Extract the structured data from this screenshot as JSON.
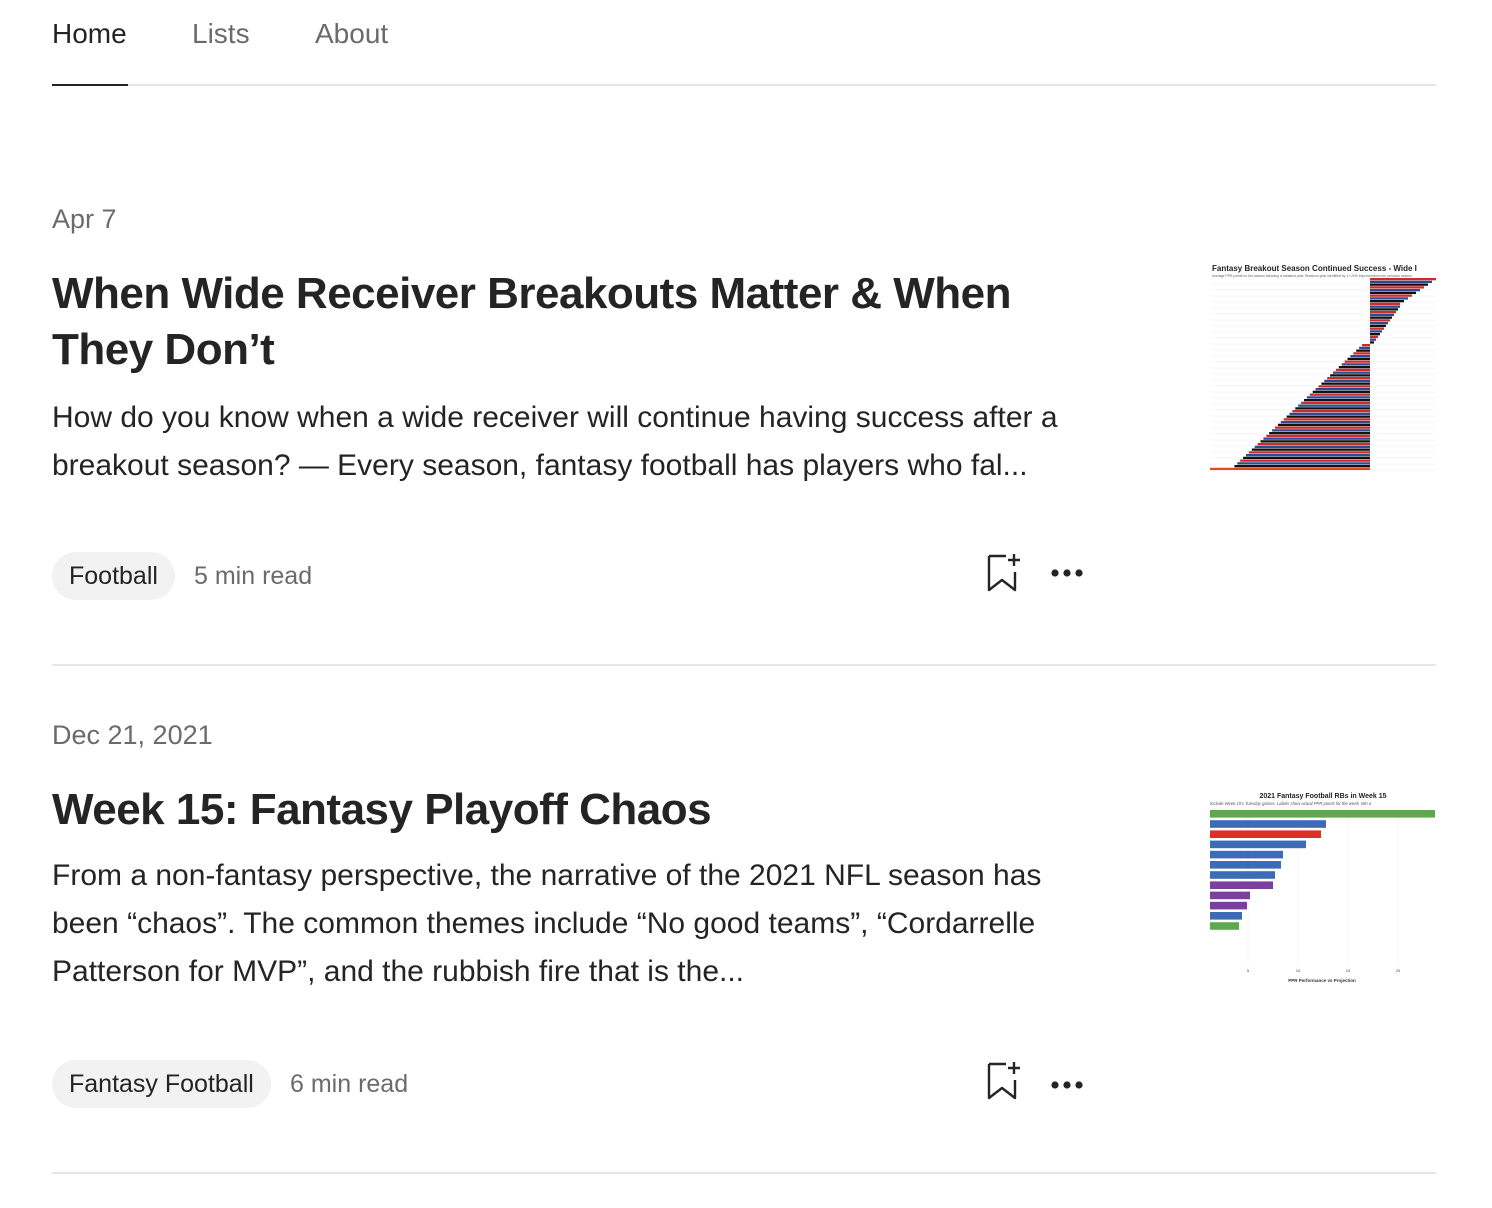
{
  "tabs": [
    {
      "label": "Home",
      "active": true
    },
    {
      "label": "Lists",
      "active": false
    },
    {
      "label": "About",
      "active": false
    }
  ],
  "articles": [
    {
      "date": "Apr 7",
      "title": "When Wide Receiver Breakouts Matter & When They Don’t",
      "excerpt": "How do you know when a wide receiver will continue having success after a breakout season? — Every season, fantasy football has players who fal...",
      "tag": "Football",
      "read_time": "5 min read",
      "thumbnail": {
        "title": "Fantasy Breakout Season Continued Success - Wide I",
        "subtitle": "Average PPR points for the season following a breakout year. Breakout year identified by 1+ 20% improvement from previous season",
        "colors": [
          "#cc2b2b",
          "#2f4b8f",
          "#111111",
          "#e04c1f"
        ]
      }
    },
    {
      "date": "Dec 21, 2021",
      "title": "Week 15: Fantasy Playoff Chaos",
      "excerpt": "From a non-fantasy perspective, the narrative of the 2021 NFL season has been “chaos”. The common themes include “No good teams”, “Cordarrelle Patterson for MVP”, and the rubbish fire that is the...",
      "tag": "Fantasy Football",
      "read_time": "6 min read",
      "thumbnail": {
        "title": "2021 Fantasy Football RBs in Week 15",
        "subtitle": "Include Week 15's Tuesday games. Labels show actual PPR points for the week. Min a",
        "xlabel": "PPR Performance vs Projection",
        "ticks": [
          "5",
          "10",
          "15",
          "20"
        ],
        "bar_values": [
          22.5,
          11.6,
          11.1,
          9.6,
          7.3,
          7.1,
          6.5,
          6.3,
          4.0,
          3.7,
          3.2,
          2.9
        ],
        "bar_colors": [
          "#5ea94d",
          "#3b6cb5",
          "#d9302c",
          "#3b6cb5",
          "#3b6cb5",
          "#3b6cb5",
          "#3b6cb5",
          "#7b3f9e",
          "#7b3f9e",
          "#7b3f9e",
          "#3b6cb5",
          "#5ea94d"
        ]
      }
    }
  ]
}
